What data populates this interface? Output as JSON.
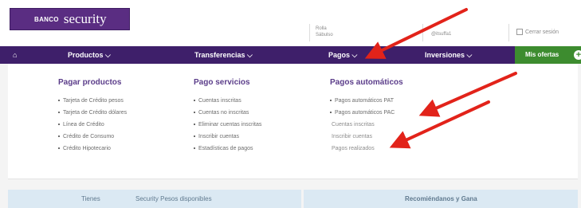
{
  "header": {
    "logo_small": "BANCO",
    "logo_big": "security",
    "user_line1": "Rolla",
    "user_line2": "Sábulso",
    "user_id": "@itsuffa1",
    "logout_label": "Cerrar sesión"
  },
  "nav": {
    "home_icon": "home-icon",
    "items": [
      {
        "label": "Productos ⌵"
      },
      {
        "label": "Transferencias ⌵"
      },
      {
        "label": "Pagos ⌵"
      },
      {
        "label": "Inversiones ⌵"
      }
    ],
    "offers_label": "Mis ofertas",
    "offers_icon": "+"
  },
  "menu": {
    "col1": {
      "title": "Pagar productos",
      "items": [
        "Tarjeta de Crédito pesos",
        "Tarjeta de Crédito dólares",
        "Línea de Crédito",
        "Crédito de Consumo",
        "Crédito Hipotecario"
      ]
    },
    "col2": {
      "title": "Pago servicios",
      "items": [
        "Cuentas inscritas",
        "Cuentas no inscritas",
        "Eliminar cuentas inscritas",
        "Inscribir cuentas",
        "Estadísticas de pagos"
      ]
    },
    "col3": {
      "title": "Pagos automáticos",
      "items": [
        "Pagos automáticos PAT",
        "Pagos automáticos PAC"
      ],
      "sub_items": [
        "Cuentas inscritas",
        "Inscribir cuentas",
        "Pagos realizados"
      ]
    }
  },
  "strip": {
    "left1": "Tienes",
    "left2": "Security Pesos disponibles",
    "right": "Recomiéndanos y Gana"
  },
  "colors": {
    "brand_purple": "#3e1f6a",
    "offers_green": "#3d8c2f",
    "annotation_red": "#e2231a"
  }
}
